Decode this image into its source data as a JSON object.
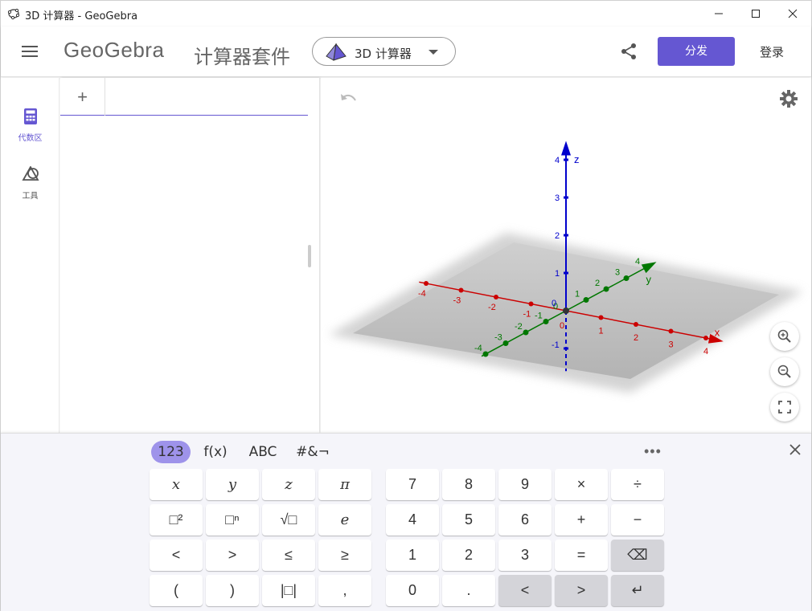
{
  "window": {
    "title": "3D 计算器 - GeoGebra"
  },
  "header": {
    "logo": "GeoGebra",
    "suite_title": "计算器套件",
    "app_select_label": "3D 计算器",
    "share_label": "分发",
    "login_label": "登录"
  },
  "sidebar": {
    "items": [
      {
        "label": "代数区",
        "icon": "calculator-icon",
        "active": true
      },
      {
        "label": "工具",
        "icon": "tools-icon",
        "active": false
      }
    ]
  },
  "algebra": {
    "add_label": "+"
  },
  "graph3d": {
    "x_axis_label": "x",
    "y_axis_label": "y",
    "z_axis_label": "z",
    "x_ticks": [
      "-4",
      "-3",
      "-2",
      "-1",
      "0",
      "1",
      "2",
      "3",
      "4"
    ],
    "y_ticks": [
      "-4",
      "-3",
      "-2",
      "-1",
      "0",
      "1",
      "2",
      "3",
      "4"
    ],
    "z_ticks": [
      "-1",
      "0",
      "1",
      "2",
      "3",
      "4"
    ],
    "colors": {
      "x_axis": "#cc0000",
      "y_axis": "#007700",
      "z_axis": "#0000cc",
      "accent": "#6557d2"
    }
  },
  "keyboard": {
    "tabs": [
      "123",
      "f(x)",
      "ABC",
      "#&¬"
    ],
    "active_tab": "123",
    "more_label": "•••",
    "left_keys": [
      [
        "x",
        "y",
        "z",
        "π"
      ],
      [
        "□²",
        "□ⁿ",
        "√□",
        "e"
      ],
      [
        "<",
        ">",
        "≤",
        "≥"
      ],
      [
        "(",
        ")",
        "|□|",
        ","
      ]
    ],
    "right_keys": [
      [
        "7",
        "8",
        "9",
        "×",
        "÷"
      ],
      [
        "4",
        "5",
        "6",
        "+",
        "−"
      ],
      [
        "1",
        "2",
        "3",
        "=",
        "⌫"
      ],
      [
        "0",
        ".",
        "<",
        ">",
        "↵"
      ]
    ]
  }
}
